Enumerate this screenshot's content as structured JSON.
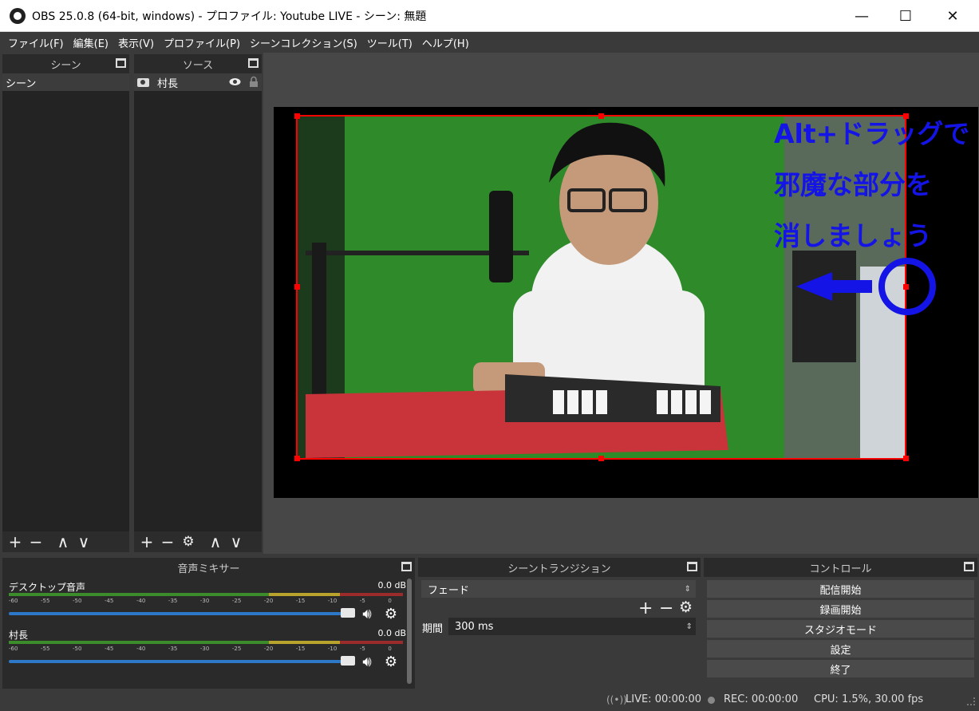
{
  "window": {
    "title": "OBS 25.0.8 (64-bit, windows) - プロファイル: Youtube LIVE - シーン: 無題",
    "minimize": "—",
    "maximize": "☐",
    "close": "✕"
  },
  "menu": [
    "ファイル(F)",
    "編集(E)",
    "表示(V)",
    "プロファイル(P)",
    "シーンコレクション(S)",
    "ツール(T)",
    "ヘルプ(H)"
  ],
  "scenes": {
    "title": "シーン",
    "items": [
      "シーン"
    ]
  },
  "sources": {
    "title": "ソース",
    "items": [
      {
        "label": "村長",
        "icon": "camera-icon"
      }
    ]
  },
  "preview": {
    "annotation_lines": [
      "Alt+ドラッグで",
      "邪魔な部分を",
      "消しましょう"
    ],
    "annotation_color": "#1414e6",
    "bounding_box_color": "#ff0000"
  },
  "mixer": {
    "title": "音声ミキサー",
    "ticks": [
      "-60",
      "-55",
      "-50",
      "-45",
      "-40",
      "-35",
      "-30",
      "-25",
      "-20",
      "-15",
      "-10",
      "-5",
      "0"
    ],
    "channels": [
      {
        "name": "デスクトップ音声",
        "db": "0.0 dB",
        "volume": 1.0
      },
      {
        "name": "村長",
        "db": "0.0 dB",
        "volume": 1.0
      }
    ]
  },
  "transitions": {
    "title": "シーントランジション",
    "selected": "フェード",
    "duration_label": "期間",
    "duration_value": "300 ms"
  },
  "controls": {
    "title": "コントロール",
    "buttons": [
      "配信開始",
      "録画開始",
      "スタジオモード",
      "設定",
      "終了"
    ]
  },
  "status": {
    "live": "LIVE: 00:00:00",
    "rec": "REC: 00:00:00",
    "cpu": "CPU: 1.5%, 30.00 fps"
  },
  "toolbar_symbols": {
    "add": "+",
    "remove": "−",
    "up": "∧",
    "down": "∨",
    "gear": "⚙"
  }
}
